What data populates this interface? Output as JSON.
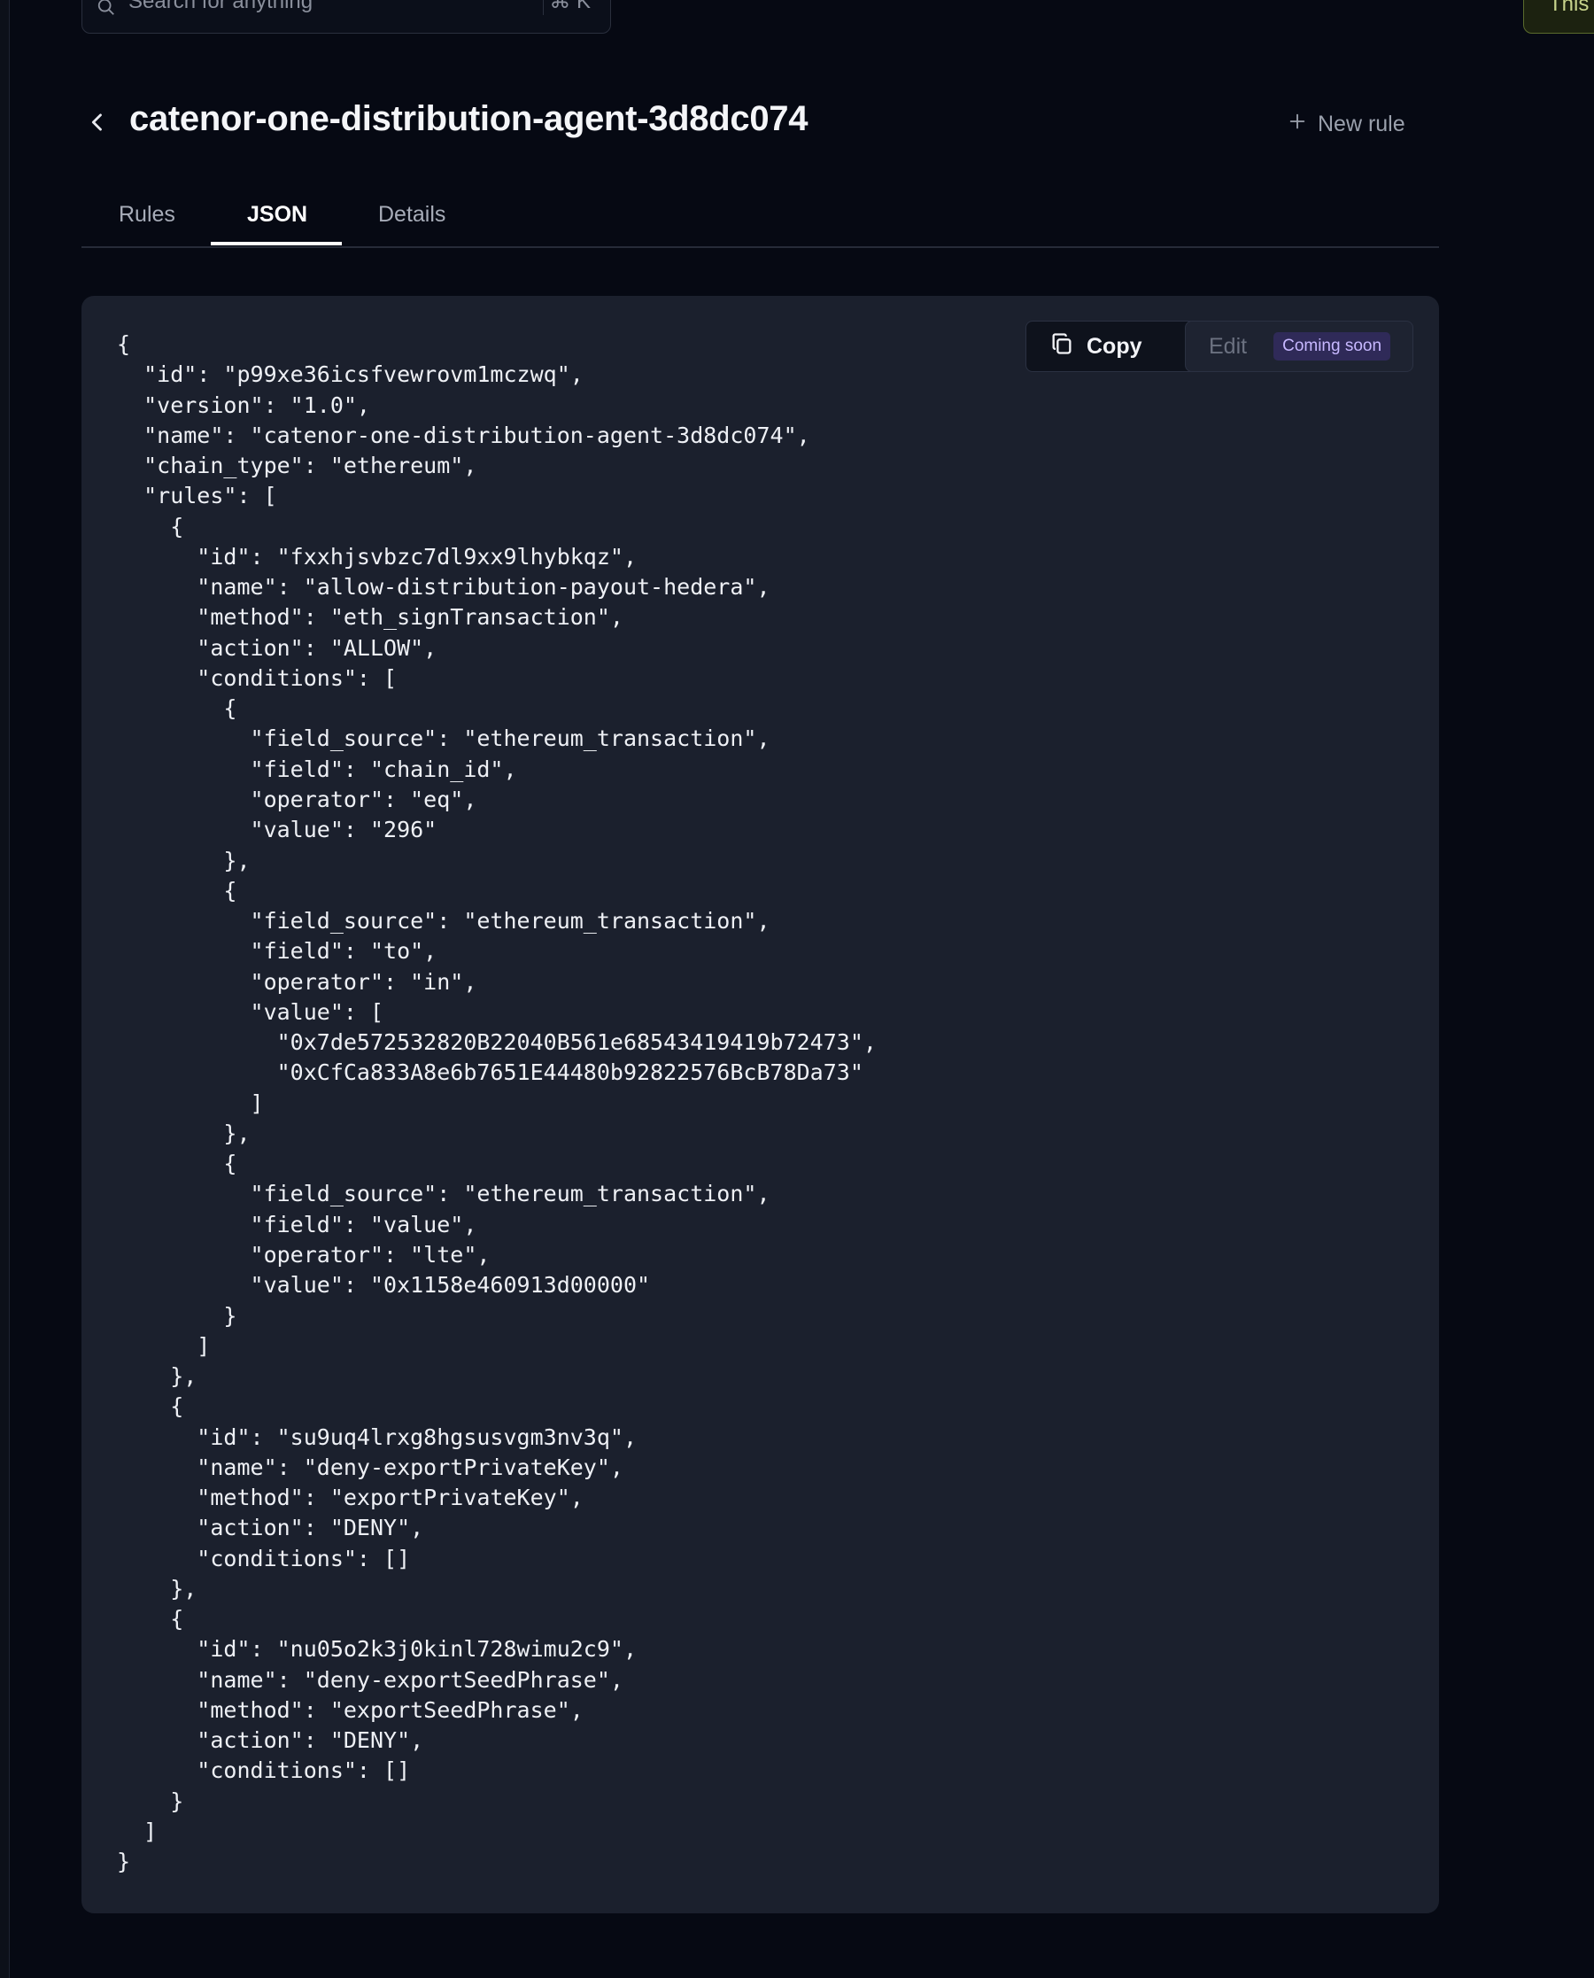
{
  "search": {
    "placeholder": "Search for anything",
    "shortcut": "⌘ K",
    "icon": "search-icon"
  },
  "corner_tag": {
    "label": "This"
  },
  "header": {
    "title": "catenor-one-distribution-agent-3d8dc074",
    "back_icon": "chevron-left-icon",
    "new_rule_label": "New rule",
    "new_rule_icon": "plus-icon"
  },
  "tabs": [
    {
      "label": "Rules",
      "active": false
    },
    {
      "label": "JSON",
      "active": true
    },
    {
      "label": "Details",
      "active": false
    }
  ],
  "toolbar": {
    "copy_label": "Copy",
    "copy_icon": "copy-icon",
    "edit_label": "Edit",
    "edit_badge": "Coming soon"
  },
  "json_text": "{\n  \"id\": \"p99xe36icsfvewrovm1mczwq\",\n  \"version\": \"1.0\",\n  \"name\": \"catenor-one-distribution-agent-3d8dc074\",\n  \"chain_type\": \"ethereum\",\n  \"rules\": [\n    {\n      \"id\": \"fxxhjsvbzc7dl9xx9lhybkqz\",\n      \"name\": \"allow-distribution-payout-hedera\",\n      \"method\": \"eth_signTransaction\",\n      \"action\": \"ALLOW\",\n      \"conditions\": [\n        {\n          \"field_source\": \"ethereum_transaction\",\n          \"field\": \"chain_id\",\n          \"operator\": \"eq\",\n          \"value\": \"296\"\n        },\n        {\n          \"field_source\": \"ethereum_transaction\",\n          \"field\": \"to\",\n          \"operator\": \"in\",\n          \"value\": [\n            \"0x7de572532820B22040B561e68543419419b72473\",\n            \"0xCfCa833A8e6b7651E44480b92822576BcB78Da73\"\n          ]\n        },\n        {\n          \"field_source\": \"ethereum_transaction\",\n          \"field\": \"value\",\n          \"operator\": \"lte\",\n          \"value\": \"0x1158e460913d00000\"\n        }\n      ]\n    },\n    {\n      \"id\": \"su9uq4lrxg8hgsusvgm3nv3q\",\n      \"name\": \"deny-exportPrivateKey\",\n      \"method\": \"exportPrivateKey\",\n      \"action\": \"DENY\",\n      \"conditions\": []\n    },\n    {\n      \"id\": \"nu05o2k3j0kinl728wimu2c9\",\n      \"name\": \"deny-exportSeedPhrase\",\n      \"method\": \"exportSeedPhrase\",\n      \"action\": \"DENY\",\n      \"conditions\": []\n    }\n  ]\n}"
}
